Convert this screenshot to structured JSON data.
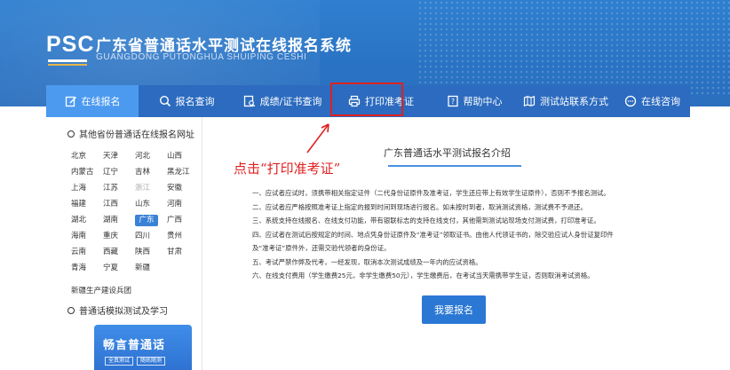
{
  "header": {
    "logo_text": "PSC",
    "title": "广东省普通话水平测试在线报名系统",
    "subtitle": "GUANGDONG PUTONGHUA SHUIPING CESHI"
  },
  "nav": {
    "items": [
      {
        "label": "在线报名",
        "icon": "edit-icon",
        "active": true
      },
      {
        "label": "报名查询",
        "icon": "search-icon",
        "active": false
      },
      {
        "label": "成绩/证书查询",
        "icon": "document-search-icon",
        "active": false
      },
      {
        "label": "打印准考证",
        "icon": "printer-icon",
        "active": false,
        "highlighted": true
      },
      {
        "label": "帮助中心",
        "icon": "help-book-icon",
        "active": false
      },
      {
        "label": "测试站联系方式",
        "icon": "map-icon",
        "active": false
      },
      {
        "label": "在线咨询",
        "icon": "chat-icon",
        "active": false
      }
    ]
  },
  "sidebar": {
    "section1_title": "其他省份普通话在线报名网址",
    "provinces": [
      {
        "name": "北京",
        "state": "normal"
      },
      {
        "name": "天津",
        "state": "normal"
      },
      {
        "name": "河北",
        "state": "normal"
      },
      {
        "name": "山西",
        "state": "normal"
      },
      {
        "name": "内蒙古",
        "state": "normal"
      },
      {
        "name": "辽宁",
        "state": "normal"
      },
      {
        "name": "吉林",
        "state": "normal"
      },
      {
        "name": "黑龙江",
        "state": "normal"
      },
      {
        "name": "上海",
        "state": "normal"
      },
      {
        "name": "江苏",
        "state": "normal"
      },
      {
        "name": "浙江",
        "state": "disabled"
      },
      {
        "name": "安徽",
        "state": "normal"
      },
      {
        "name": "福建",
        "state": "normal"
      },
      {
        "name": "江西",
        "state": "normal"
      },
      {
        "name": "山东",
        "state": "normal"
      },
      {
        "name": "河南",
        "state": "normal"
      },
      {
        "name": "湖北",
        "state": "normal"
      },
      {
        "name": "湖南",
        "state": "normal"
      },
      {
        "name": "广东",
        "state": "active"
      },
      {
        "name": "广西",
        "state": "normal"
      },
      {
        "name": "海南",
        "state": "normal"
      },
      {
        "name": "重庆",
        "state": "normal"
      },
      {
        "name": "四川",
        "state": "normal"
      },
      {
        "name": "贵州",
        "state": "normal"
      },
      {
        "name": "云南",
        "state": "normal"
      },
      {
        "name": "西藏",
        "state": "normal"
      },
      {
        "name": "陕西",
        "state": "normal"
      },
      {
        "name": "甘肃",
        "state": "normal"
      },
      {
        "name": "青海",
        "state": "normal"
      },
      {
        "name": "宁夏",
        "state": "normal"
      },
      {
        "name": "新疆",
        "state": "normal"
      }
    ],
    "extra_link": "新疆生产建设兵团",
    "section2_title": "普通话模拟测试及学习",
    "promo": {
      "title": "畅言普通话",
      "tags": [
        "全真测试",
        "随练随测"
      ]
    }
  },
  "main": {
    "title": "广东普通话水平测试报名介绍",
    "annotation": "点击“打印准考证”",
    "notices": [
      "一、应试者应试时，须携带相关指定证件（二代身份证原件及准考证，学生还应带上有效学生证原件），否则不予报名测试。",
      "二、应试者应严格按照准考证上指定的报到时间到现场进行报名。如未按时到者，取消测试资格，测试费不予退还。",
      "三、系统支持在线报名、在线支付功能，带有银联标志的支持在线支付，其他需到测试站现场支付测试费，打印准考证。",
      "四、应试者在测试后按规定的时间、地点凭身份证原件及“准考证”领取证书。由他人代领证书的，除交验应试人身份证复印件",
      "及“准考证”原件外，还需交验代领者的身份证。",
      "五、考试严禁作弊及代考，一经发现，取消本次测试成绩及一年内的应试资格。",
      "六、在线支付费用（学生缴费25元，非学生缴费50元），学生缴费后，在考试当天需携带学生证，否则取消考试资格。"
    ],
    "register_button": "我要报名"
  },
  "colors": {
    "banner": "#2f7fd0",
    "nav_bg": "#2c6bbf",
    "nav_active": "#4b9af0",
    "highlight": "#e02020",
    "button": "#2a78d4"
  }
}
